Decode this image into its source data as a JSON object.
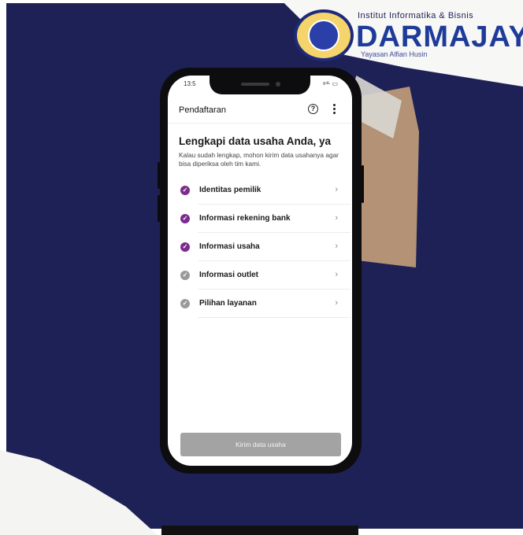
{
  "branding": {
    "tagline": "Institut Informatika & Bisnis",
    "name": "DARMAJAYA",
    "foundation": "Yayasan Alfian Husin"
  },
  "status_bar": {
    "time": "13:5",
    "icons": "ᵍ⁴ᴸ ▭"
  },
  "app_bar": {
    "title": "Pendaftaran",
    "help_glyph": "?"
  },
  "content": {
    "heading": "Lengkapi data usaha Anda, ya",
    "description": "Kalau sudah lengkap, mohon kirim data usahanya agar bisa diperiksa oleh tim kami."
  },
  "checklist": [
    {
      "label": "Identitas pemilik",
      "completed": true
    },
    {
      "label": "Informasi rekening bank",
      "completed": true
    },
    {
      "label": "Informasi usaha",
      "completed": true
    },
    {
      "label": "Informasi outlet",
      "completed": false
    },
    {
      "label": "Pilihan layanan",
      "completed": false
    }
  ],
  "glyphs": {
    "check": "✓",
    "chevron": "›"
  },
  "submit_button": {
    "label": "Kirim data usaha",
    "enabled": false
  },
  "colors": {
    "navy_background": "#1e2156",
    "completed": "#7b2d8e",
    "pending": "#9a9a9a",
    "button_disabled": "#a3a3a3",
    "brand_blue": "#1f3b9a"
  },
  "icons": [
    "logo-emblem",
    "help-icon",
    "more-vert-icon",
    "check-circle-icon",
    "chevron-right-icon"
  ]
}
